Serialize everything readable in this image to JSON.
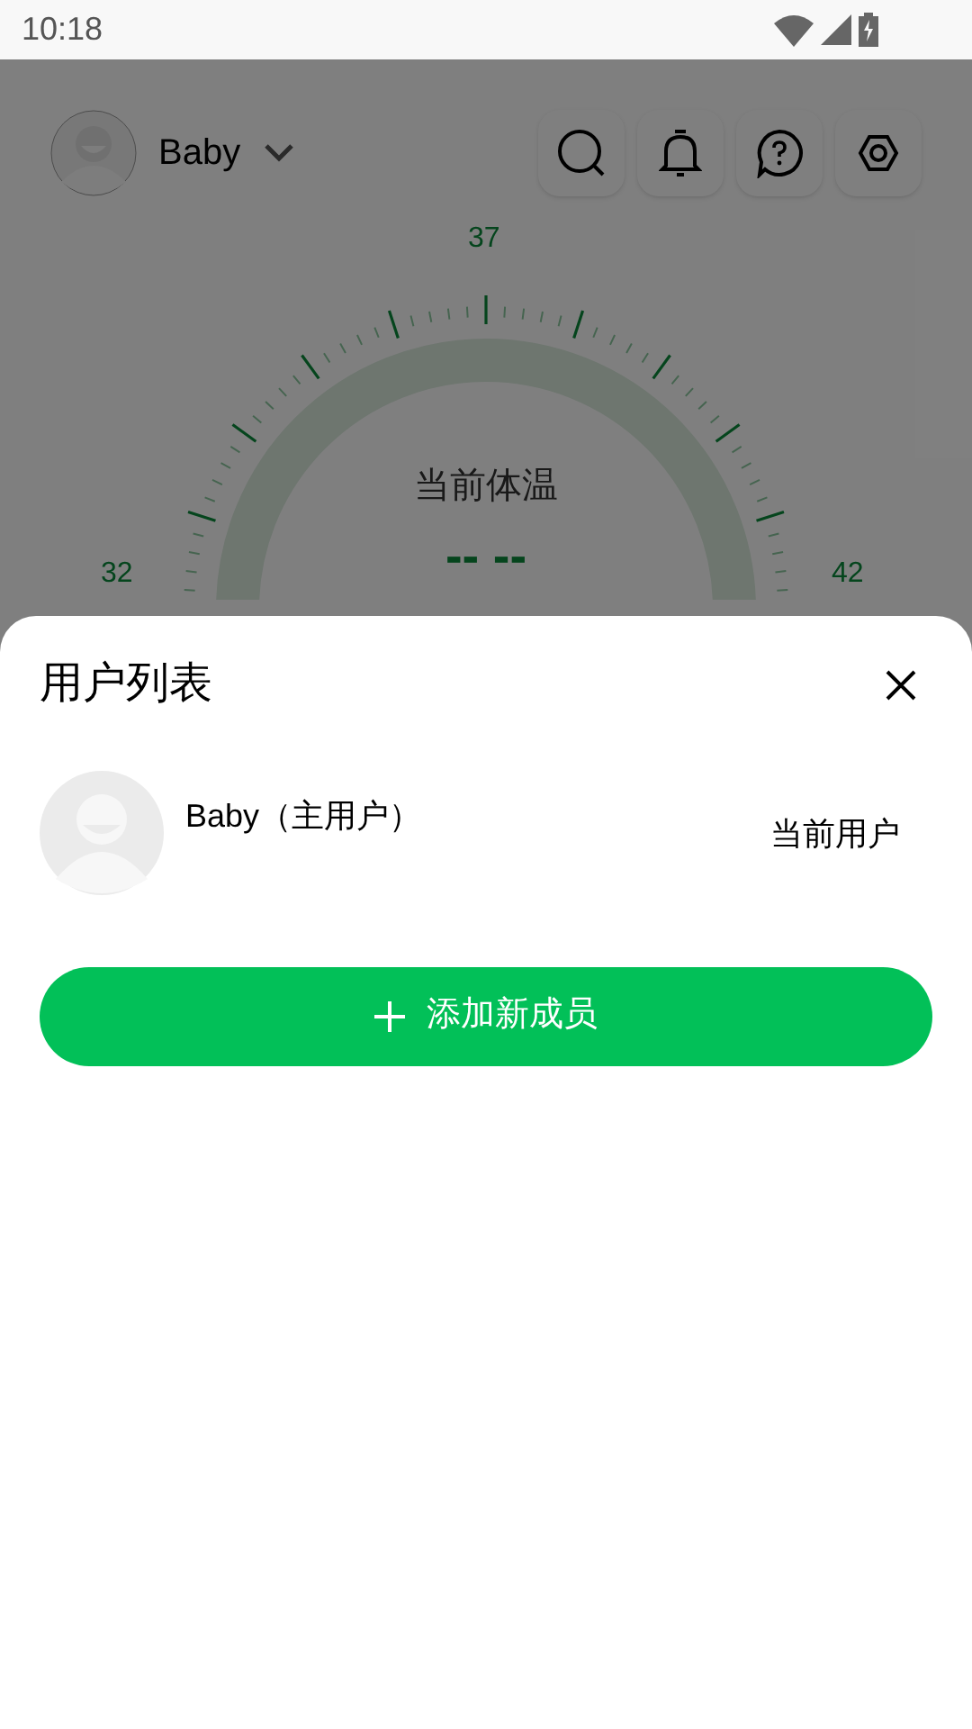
{
  "status_bar": {
    "time": "10:18"
  },
  "header": {
    "user_name": "Baby"
  },
  "gauge": {
    "title": "当前体温",
    "reading": "-- --",
    "scale_labels": [
      "32",
      "37",
      "42"
    ]
  },
  "sheet": {
    "title": "用户列表",
    "users": [
      {
        "name": "Baby（主用户）",
        "status": "当前用户"
      }
    ],
    "add_button": "添加新成员"
  }
}
